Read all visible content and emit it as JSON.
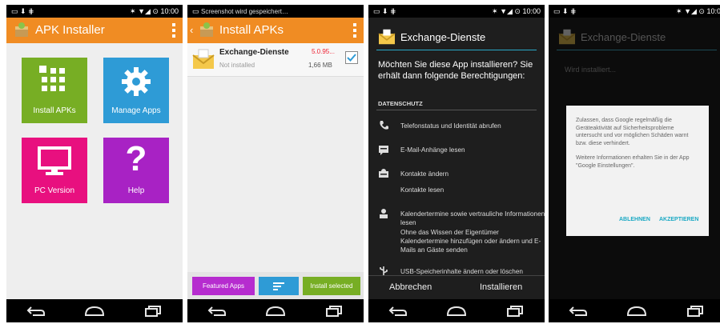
{
  "status": {
    "time": "10:00",
    "screenshot_notice": "Screenshot wird gespeichert…",
    "time_partial": "10:0"
  },
  "screen1": {
    "title": "APK Installer",
    "tiles": [
      {
        "label": "Install APKs",
        "color": "#77ae24"
      },
      {
        "label": "Manage Apps",
        "color": "#2e9bd6"
      },
      {
        "label": "PC Version",
        "color": "#e8107f"
      },
      {
        "label": "Help",
        "color": "#a822c4"
      }
    ]
  },
  "screen2": {
    "title": "Install APKs",
    "item": {
      "name": "Exchange-Dienste",
      "version": "5.0.95...",
      "status": "Not installed",
      "size": "1,66 MB",
      "checked": true
    },
    "buttons": [
      {
        "label": "Featured Apps",
        "color": "#b62ccf"
      },
      {
        "label": "",
        "color": "#2e9bd6",
        "icon": "sort-icon"
      },
      {
        "label": "Install selected",
        "color": "#77ae24"
      }
    ]
  },
  "screen3": {
    "title": "Exchange-Dienste",
    "question": "Möchten Sie diese App installieren? Sie erhält dann folgende Berechtigungen:",
    "section": "DATENSCHUTZ",
    "permissions": [
      {
        "icon": "phone-icon",
        "text": "Telefonstatus und Identität abrufen"
      },
      {
        "icon": "email-attachment-icon",
        "text": "E-Mail-Anhänge lesen"
      },
      {
        "icon": "contacts-icon",
        "text": "Kontakte ändern"
      },
      {
        "icon": "",
        "text": "Kontakte lesen"
      },
      {
        "icon": "calendar-icon",
        "text": "Kalendertermine sowie vertrauliche Informationen lesen"
      },
      {
        "icon": "",
        "text": "Ohne das Wissen der Eigentümer Kalendertermine hinzufügen oder ändern und E-Mails an Gäste senden"
      },
      {
        "icon": "usb-icon",
        "text": "USB-Speicherinhalte ändern oder löschen"
      }
    ],
    "cancel": "Abbrechen",
    "install": "Installieren"
  },
  "screen4": {
    "title": "Exchange-Dienste",
    "installing": "Wird installiert...",
    "dialog_text1": "Zulassen, dass Google regelmäßig die Geräteaktivität auf Sicherheitsprobleme untersucht und vor möglichen Schäden warnt bzw. diese verhindert.",
    "dialog_text2": "Weitere Informationen erhalten Sie in der App \"Google Einstellungen\".",
    "decline": "ABLEHNEN",
    "accept": "AKZEPTIEREN"
  }
}
